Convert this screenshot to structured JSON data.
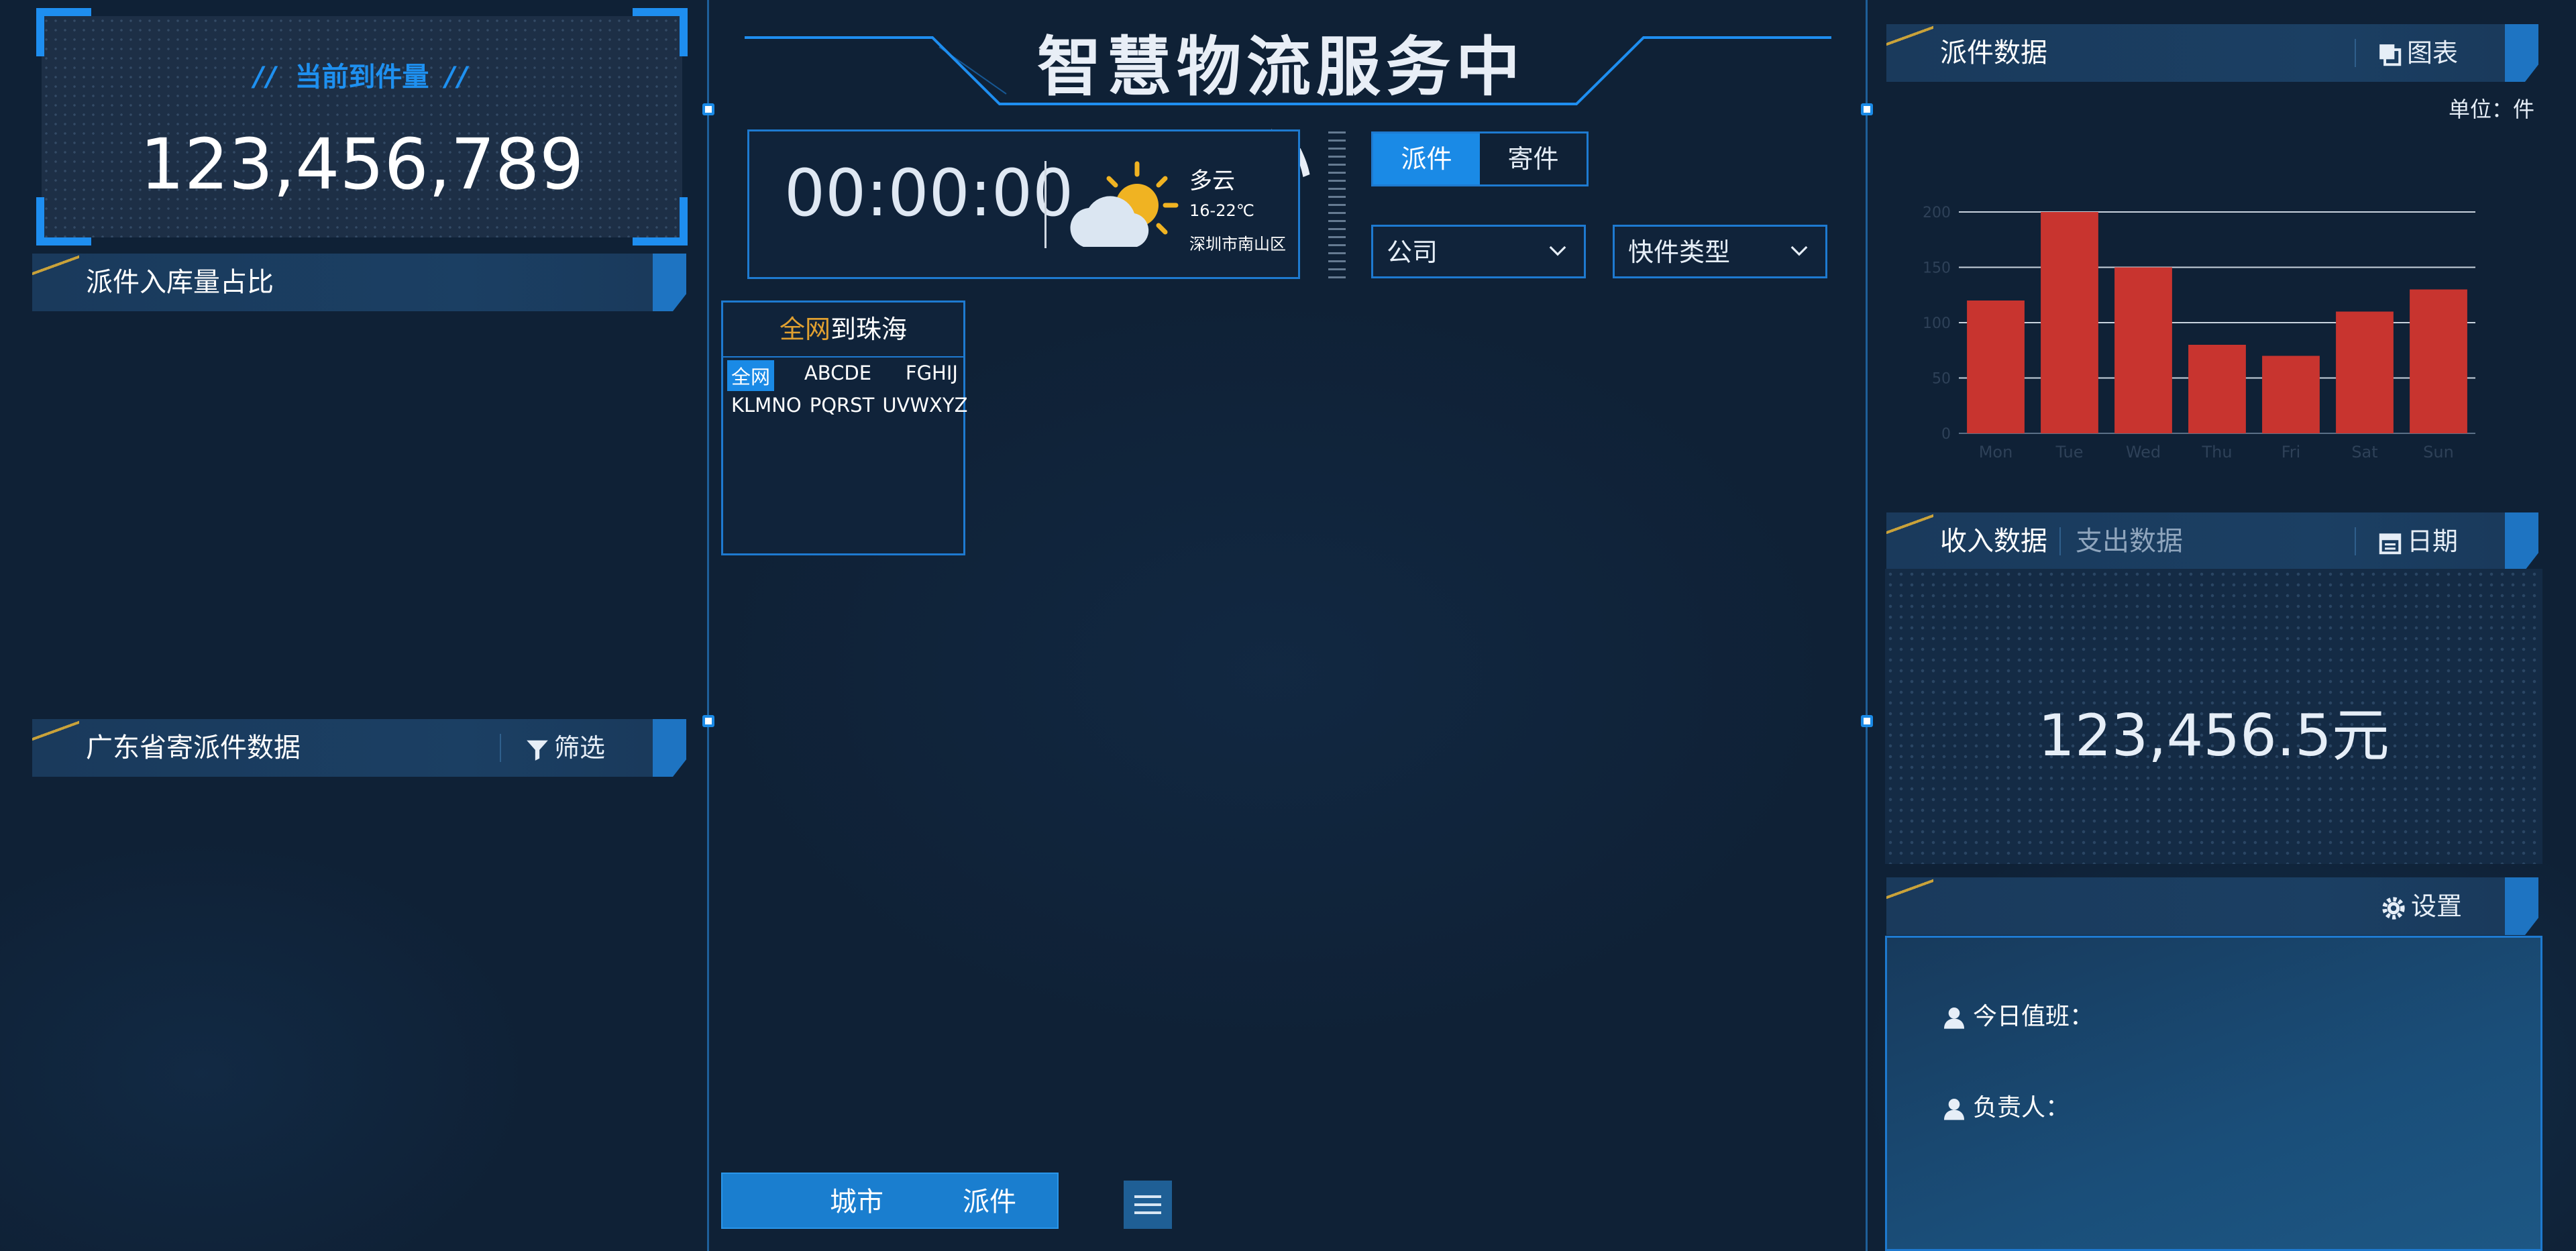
{
  "header": {
    "title": "智慧物流服务中心"
  },
  "counter": {
    "title_prefix": "//",
    "title": "当前到件量",
    "title_suffix": "//",
    "value": "123,456,789"
  },
  "left_sections": {
    "ratio_title": "派件入库量占比",
    "province_title": "广东省寄派件数据",
    "filter_label": "筛选"
  },
  "clock": {
    "time": "00:00:00"
  },
  "weather": {
    "desc": "多云",
    "temp": "16-22℃",
    "location": "深圳市南山区"
  },
  "toggle": {
    "option1": "派件",
    "option2": "寄件",
    "selected": "派件"
  },
  "selects": {
    "company": "公司",
    "express_type": "快件类型"
  },
  "area": {
    "head_highlight": "全网",
    "head_rest": "到珠海",
    "row1": [
      "全网",
      "ABCDE",
      "FGHIJ"
    ],
    "row2": [
      "KLMNO",
      "PQRST",
      "UVWXYZ"
    ],
    "selected": "全网"
  },
  "bottom": {
    "city": "城市",
    "delivery": "派件"
  },
  "right": {
    "dispatch_title": "派件数据",
    "chart_label": "图表",
    "unit": "单位：件",
    "income_tab": "收入数据",
    "expense_tab": "支出数据",
    "date_label": "日期",
    "income_value": "123,456.5元",
    "settings_label": "设置",
    "duty_today": "今日值班：",
    "duty_owner": "负责人："
  },
  "colors": {
    "accent": "#1a8ae6",
    "bar": "#c8342f",
    "highlight": "#e0a030",
    "stripe": "#c9a23a"
  },
  "chart_data": {
    "type": "bar",
    "categories": [
      "Mon",
      "Tue",
      "Wed",
      "Thu",
      "Fri",
      "Sat",
      "Sun"
    ],
    "values": [
      120,
      200,
      150,
      80,
      70,
      110,
      130
    ],
    "yticks": [
      0,
      50,
      100,
      150,
      200
    ],
    "ylim": [
      0,
      200
    ],
    "grid": true,
    "title": "",
    "xlabel": "",
    "ylabel": ""
  }
}
